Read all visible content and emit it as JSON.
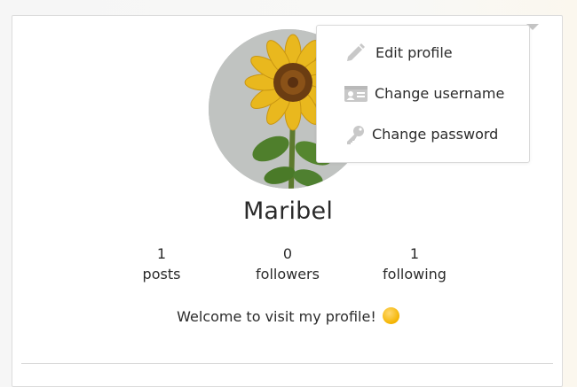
{
  "profile": {
    "name": "Maribel",
    "bio": "Welcome to visit my profile!",
    "stats": [
      {
        "value": "1",
        "label": "posts"
      },
      {
        "value": "0",
        "label": "followers"
      },
      {
        "value": "1",
        "label": "following"
      }
    ]
  },
  "menu": {
    "items": [
      {
        "label": "Edit profile",
        "icon": "pencil-icon"
      },
      {
        "label": "Change username",
        "icon": "id-card-icon"
      },
      {
        "label": "Change password",
        "icon": "key-icon"
      }
    ]
  },
  "colors": {
    "icon_gray": "#c8c8c8",
    "text": "#2b2b2b",
    "border": "#dadada"
  }
}
